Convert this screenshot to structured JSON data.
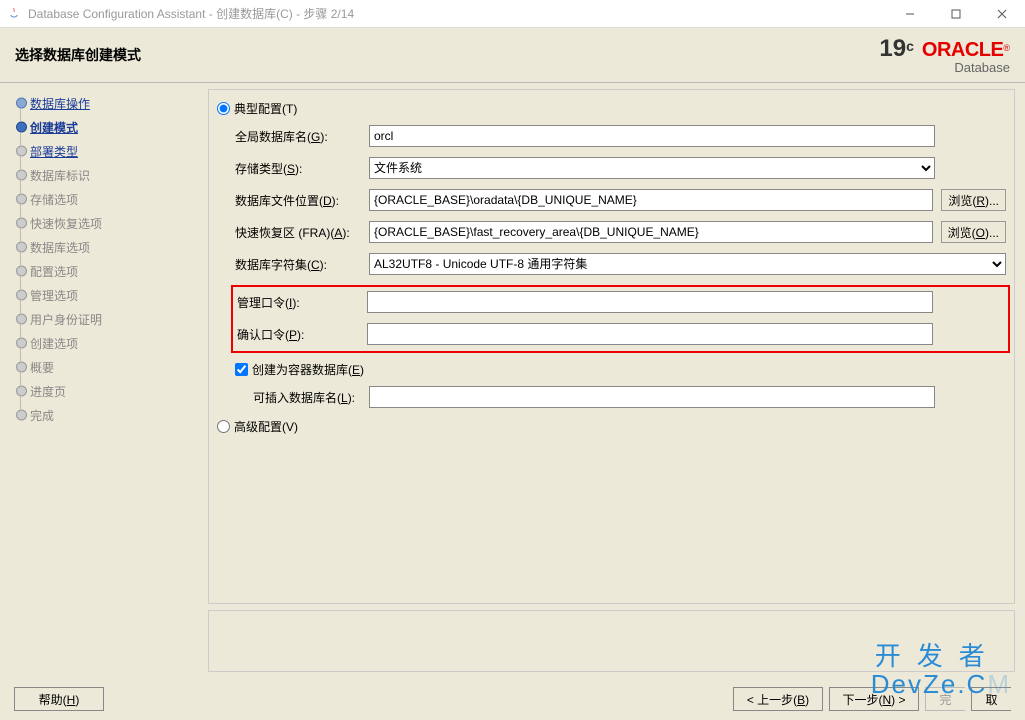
{
  "titlebar": {
    "title": "Database Configuration Assistant - 创建数据库(C) - 步骤 2/14"
  },
  "header": {
    "title": "选择数据库创建模式",
    "brand_version": "19",
    "brand_sup": "c",
    "brand_name": "ORACLE",
    "brand_sub": "Database"
  },
  "sidebar": {
    "steps": [
      {
        "label": "数据库操作",
        "state": "done",
        "link": true
      },
      {
        "label": "创建模式",
        "state": "active",
        "link": true
      },
      {
        "label": "部署类型",
        "state": "pending",
        "link": true
      },
      {
        "label": "数据库标识",
        "state": "pending",
        "link": false
      },
      {
        "label": "存储选项",
        "state": "pending",
        "link": false
      },
      {
        "label": "快速恢复选项",
        "state": "pending",
        "link": false
      },
      {
        "label": "数据库选项",
        "state": "pending",
        "link": false
      },
      {
        "label": "配置选项",
        "state": "pending",
        "link": false
      },
      {
        "label": "管理选项",
        "state": "pending",
        "link": false
      },
      {
        "label": "用户身份证明",
        "state": "pending",
        "link": false
      },
      {
        "label": "创建选项",
        "state": "pending",
        "link": false
      },
      {
        "label": "概要",
        "state": "pending",
        "link": false
      },
      {
        "label": "进度页",
        "state": "pending",
        "link": false
      },
      {
        "label": "完成",
        "state": "pending",
        "link": false
      }
    ]
  },
  "form": {
    "typical_label": "典型配置(T)",
    "global_db_label": "全局数据库名(G):",
    "global_db_value": "orcl",
    "storage_type_label": "存储类型(S):",
    "storage_type_value": "文件系统",
    "db_file_loc_label": "数据库文件位置(D):",
    "db_file_loc_value": "{ORACLE_BASE}\\oradata\\{DB_UNIQUE_NAME}",
    "fra_label": "快速恢复区 (FRA)(A):",
    "fra_value": "{ORACLE_BASE}\\fast_recovery_area\\{DB_UNIQUE_NAME}",
    "charset_label": "数据库字符集(C):",
    "charset_value": "AL32UTF8 - Unicode UTF-8 通用字符集",
    "admin_pwd_label": "管理口令(I):",
    "admin_pwd_value": "",
    "confirm_pwd_label": "确认口令(P):",
    "confirm_pwd_value": "",
    "container_label": "创建为容器数据库(E)",
    "container_checked": true,
    "pdb_name_label": "可插入数据库名(L):",
    "pdb_name_value": "",
    "advanced_label": "高级配置(V)",
    "browse_r": "浏览(R)...",
    "browse_o": "浏览(O)..."
  },
  "footer": {
    "help": "帮助(H)",
    "back": "< 上一步(B)",
    "next": "下一步(N) >",
    "finish_partial": "完",
    "cancel_partial": "取"
  },
  "watermark": {
    "line1": "开发者",
    "line2": "DevZe.C"
  }
}
